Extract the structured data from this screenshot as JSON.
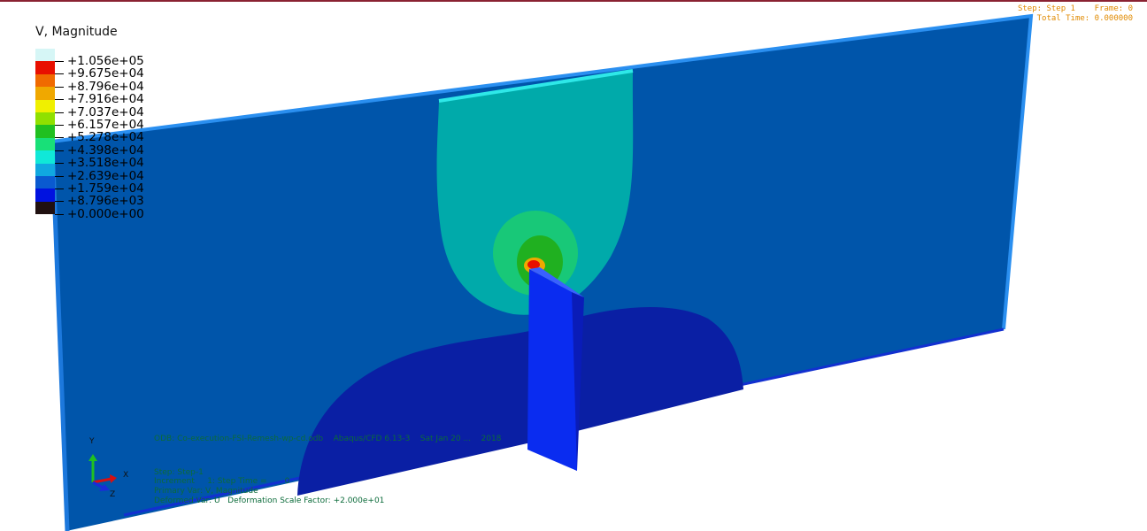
{
  "status": {
    "step_line": "Step: Step 1    Frame: 0",
    "time_line": "Total Time: 0.000000"
  },
  "legend": {
    "title": "V, Magnitude",
    "entries": [
      {
        "label": "+1.056e+05",
        "color": "#d6f6f6"
      },
      {
        "label": "+9.675e+04",
        "color": "#e81000"
      },
      {
        "label": "+8.796e+04",
        "color": "#f06a00"
      },
      {
        "label": "+7.916e+04",
        "color": "#f0a800"
      },
      {
        "label": "+7.037e+04",
        "color": "#f0f000"
      },
      {
        "label": "+6.157e+04",
        "color": "#90e000"
      },
      {
        "label": "+5.278e+04",
        "color": "#20c020"
      },
      {
        "label": "+4.398e+04",
        "color": "#18e078"
      },
      {
        "label": "+3.518e+04",
        "color": "#10e8d8"
      },
      {
        "label": "+2.639e+04",
        "color": "#10a8e0"
      },
      {
        "label": "+1.759e+04",
        "color": "#0a5ad0"
      },
      {
        "label": "+8.796e+03",
        "color": "#0012e0"
      },
      {
        "label": "+0.000e+00",
        "color": "#201010"
      }
    ]
  },
  "info": {
    "odb_line": "ODB: Co-execution-FSI-Remesh-wp-cd.odb    Abaqus/CFD 6.13-3    Sat Jan 20 ...    2018",
    "step_line": "Step: Step-1",
    "increment_line": "Increment     1: Step Time =       0",
    "primary_var_line": "Primary Var: V, Magnitude",
    "deformed_var_line": "Deformed Var: U   Deformation Scale Factor: +2.000e+01"
  },
  "triad": {
    "y": "Y",
    "x": "X",
    "z": "Z"
  },
  "colors": {
    "plate": "#0055aa",
    "plate_edge": "#2a8ff0",
    "plume": "#00aaaa",
    "lower_region": "#0a1fa4",
    "flap": "#0a2cf0",
    "flap_side": "#0a1cb8",
    "header_bar": "#8a2232"
  }
}
